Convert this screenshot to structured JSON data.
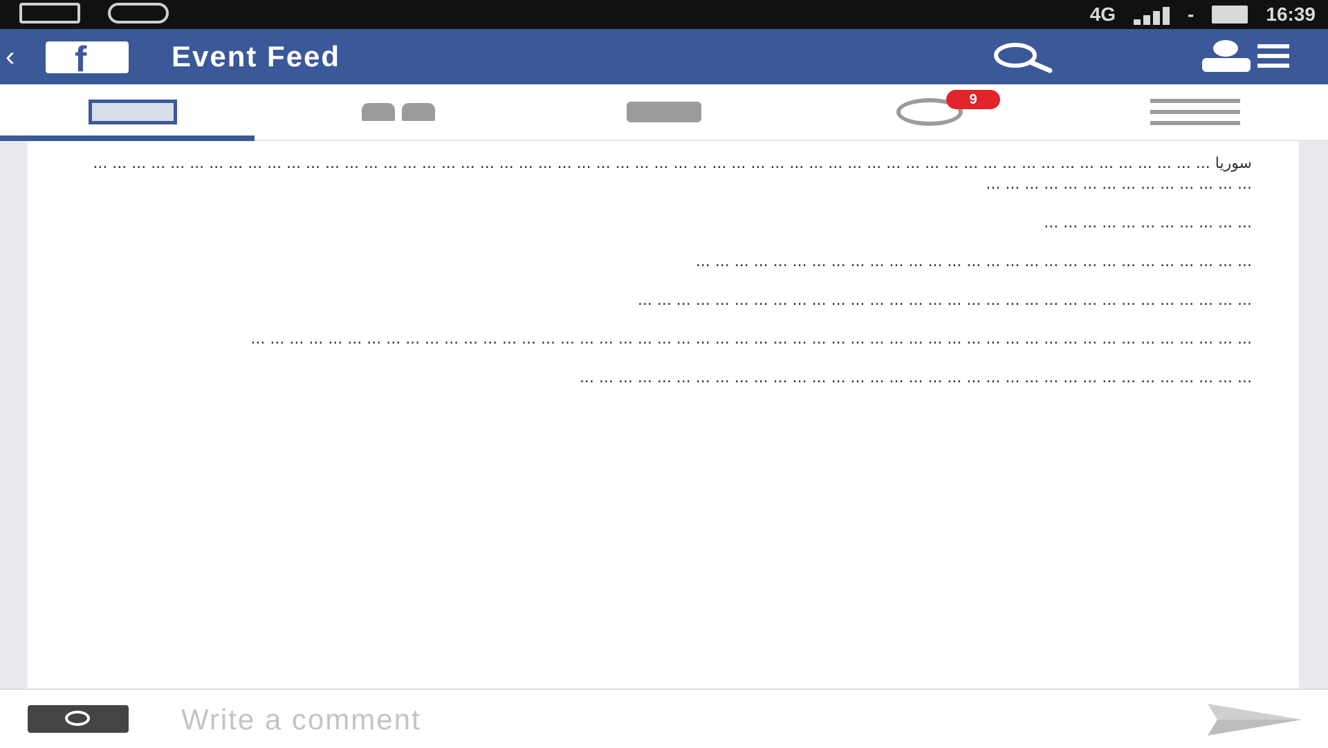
{
  "status_bar": {
    "network_label": "4G",
    "carrier_label": "-",
    "time": "16:39",
    "icon_left_1": "notification-box-icon",
    "icon_left_2": "whatsapp-icon"
  },
  "app_header": {
    "logo_text": "f",
    "title": "Event Feed",
    "search_icon": "search-icon",
    "friends_icon": "friend-requests-icon",
    "brand_color": "#3b5998"
  },
  "tabs": [
    {
      "name": "news-feed",
      "icon": "news-feed-icon",
      "active": true
    },
    {
      "name": "friends",
      "icon": "friends-icon",
      "active": false
    },
    {
      "name": "messages",
      "icon": "messages-icon",
      "active": false
    },
    {
      "name": "notifications",
      "icon": "globe-icon",
      "active": false,
      "badge": "9"
    },
    {
      "name": "more",
      "icon": "menu-icon",
      "active": false
    }
  ],
  "post": {
    "paragraphs": [
      "سوريا ... ... ... ... ... ... ... ... ... ... ... ... ... ... ... ... ... ... ... ... ... ... ... ... ... ... ... ... ... ... ... ... ... ... ... ... ... ... ... ... ... ... ... ... ... ... ... ... ... ... ... ... ... ... ... ... ... ... ... ... ... ... ... ... ... ... ... ... ... ... ... ...",
      "... ... ... ... ... ... ... ... ... ... ...",
      "... ... ... ... ... ... ... ... ... ... ... ... ... ... ... ... ... ... ... ... ... ... ... ... ... ... ... ... ...",
      "... ... ... ... ... ... ... ... ... ... ... ... ... ... ... ... ... ... ... ... ... ... ... ... ... ... ... ... ... ... ... ...",
      "... ... ... ... ... ... ... ... ... ... ... ... ... ... ... ... ... ... ... ... ... ... ... ... ... ... ... ... ... ... ... ... ... ... ... ... ... ... ... ... ... ... ... ... ... ... ... ... ... ... ... ...",
      "... ... ... ... ... ... ... ... ... ... ... ... ... ... ... ... ... ... ... ... ... ... ... ... ... ... ... ... ... ... ... ... ... ... ..."
    ]
  },
  "comment_bar": {
    "camera_icon": "camera-icon",
    "placeholder": "Write a comment",
    "send_icon": "send-icon"
  }
}
